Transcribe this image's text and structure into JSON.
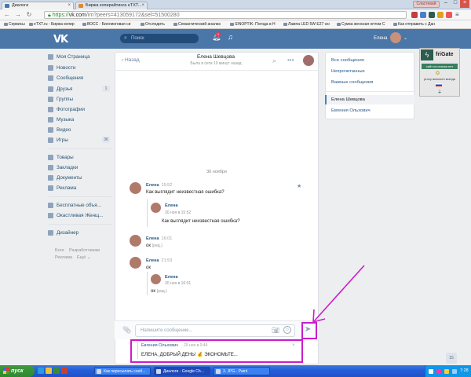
{
  "browser": {
    "tabs": [
      {
        "label": "Диалоги",
        "active": true
      },
      {
        "label": "Биржа копирайтинга eTXT...",
        "active": false
      }
    ],
    "user_badge": "Сластевий",
    "url_scheme": "https://",
    "url_host": "vk.com",
    "url_path": "/im?peers=413059172&sel=51500280",
    "bookmarks": [
      "Сервисы",
      "eTXT.ru - Биржа копир",
      "ВОСС - Биллинговая си",
      "Отследить",
      "Семантический анализ",
      "SINOPTIK: Погода в Н",
      "Лампа LED 5W E27 сю",
      "Сумка женская оптом С",
      "Как отправить с Дан"
    ]
  },
  "vk": {
    "search_placeholder": "Поиск",
    "bell_badge": "1",
    "username": "Елена",
    "nav": [
      {
        "label": "Моя Страница",
        "count": ""
      },
      {
        "label": "Новости",
        "count": ""
      },
      {
        "label": "Сообщения",
        "count": ""
      },
      {
        "label": "Друзья",
        "count": "1"
      },
      {
        "label": "Группы",
        "count": ""
      },
      {
        "label": "Фотографии",
        "count": ""
      },
      {
        "label": "Музыка",
        "count": ""
      },
      {
        "label": "Видео",
        "count": ""
      },
      {
        "label": "Игры",
        "count": "36"
      },
      {
        "label": "Товары",
        "count": ""
      },
      {
        "label": "Закладки",
        "count": ""
      },
      {
        "label": "Документы",
        "count": ""
      },
      {
        "label": "Реклама",
        "count": ""
      },
      {
        "label": "Бесплатные объя...",
        "count": ""
      },
      {
        "label": "Окастливая Женщ...",
        "count": ""
      },
      {
        "label": "Дизайнер",
        "count": ""
      }
    ],
    "footer_links": [
      "Блог",
      "Разработчикам",
      "Реклама",
      "Ещё ⌄"
    ]
  },
  "chat": {
    "back_label": "Назад",
    "title": "Елена Шевцова",
    "subtitle": "Была в сети 10 минут назад",
    "date_separator": "30 ноября",
    "messages": [
      {
        "name": "Елена",
        "time": "15:52",
        "text": "Как выглядит неизвестная ошибка?",
        "fwd": {
          "name": "Елена",
          "time": "30 ноя в 15:52",
          "text": "Как выглядит неизвестная ошибка?"
        }
      },
      {
        "name": "Елена",
        "time": "16:01",
        "text": "ок",
        "edited": "(ред.)"
      },
      {
        "name": "Елена",
        "time": "21:53",
        "text": "ок",
        "fwd": {
          "name": "Елена",
          "time": "30 ноя в 16:01",
          "text": "ок",
          "edited": "(ред.)"
        }
      }
    ],
    "input_placeholder": "Напишите сообщение...",
    "reply": {
      "name": "Евгения Ольхович",
      "time": "29 ноя в 0:44",
      "text": "ЕЛЕНА, ДОБРЫЙ ДЕНЬ! 💰 ЭКОНОМЬТЕ..."
    },
    "scroll_count": "15"
  },
  "right": {
    "links": [
      "Все сообщения",
      "Непрочитанные",
      "Важные сообщения"
    ],
    "dialogs": [
      {
        "label": "Елена Шевцова",
        "active": true
      },
      {
        "label": "Евгения Ольхович",
        "active": false
      }
    ]
  },
  "frigate": {
    "name": "friGate",
    "site_status": "сайт из списка нет",
    "proxy_status": "proxy включен всегда"
  },
  "taskbar": {
    "start_label": "пуск",
    "windows": [
      {
        "label": "Как пересылать сооб...",
        "active": false
      },
      {
        "label": "Диалоги - Google Ch...",
        "active": true
      },
      {
        "label": "3. JPG - Paint",
        "active": false
      }
    ],
    "clock": "7:28"
  },
  "colors": {
    "vk_blue": "#4a76a8",
    "annotation_magenta": "#cc1ccc",
    "link_blue": "#2a5885"
  }
}
